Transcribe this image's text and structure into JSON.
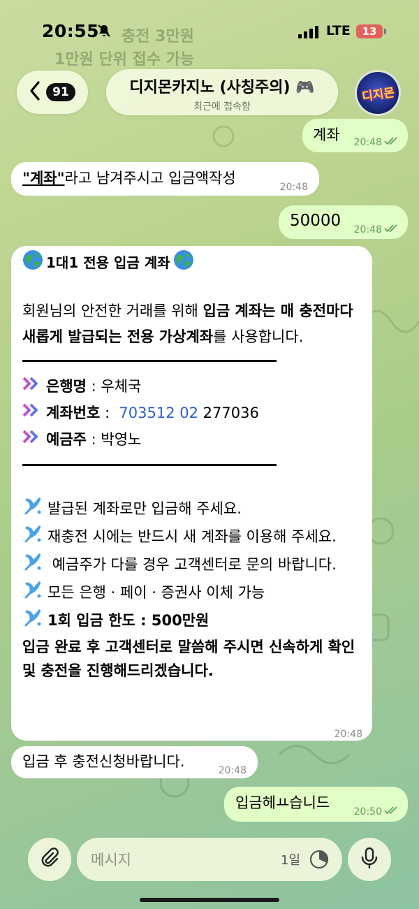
{
  "status_bar": {
    "time": "20:55",
    "network": "LTE",
    "battery": "13"
  },
  "background_ghost_text": [
    "충전 3만원",
    "1만원 단위 접수 가능"
  ],
  "header": {
    "back_count": "91",
    "title": "디지몬카지노 (사칭주의) 🎮",
    "subtitle": "최근에 접속함",
    "avatar_text": "디지몬"
  },
  "messages": {
    "m1": {
      "text": "계좌",
      "time": "20:48"
    },
    "m2": {
      "quoted": "\"계좌\"",
      "rest": "라고 남겨주시고 입금액작성",
      "time": "20:48"
    },
    "m3": {
      "text": "50000",
      "time": "20:48"
    },
    "m4": {
      "heading": "1대1 전용 입금 계좌",
      "para_1": "회원님의 안전한 거래를 위해 ",
      "para_bold": "입금 계좌는 매 충전마다 새롭게 발급되는 전용 가상계좌",
      "para_2": "를 사용합니다.",
      "bank_label": "은행명",
      "bank_value": " : 우체국",
      "account_label": "계좌번호",
      "account_sep": " : ",
      "account_link": "703512 02",
      "account_rest": " 277036",
      "holder_label": "예금주",
      "holder_value": " : 박영노",
      "note_1": "발급된 계좌로만 입금해 주세요.",
      "note_2": "재충전 시에는 반드시 새 계좌를 이용해 주세요.",
      "note_3": " 예금주가 다를 경우 고객센터로 문의 바랍니다.",
      "note_4": "모든 은행 · 페이 · 증권사 이체 가능",
      "note_5": "1회 입금 한도 : 500만원",
      "closing": "입금 완료 후 고객센터로 말씀해 주시면 신속하게 확인 및 충전을 진행해드리겠습니다.",
      "time": "20:48"
    },
    "m5": {
      "text": "입금 후 충전신청바랍니다.",
      "time": "20:48"
    },
    "m6": {
      "text": "입금헤ㅛ습니드",
      "time": "20:50"
    }
  },
  "composer": {
    "placeholder": "메시지",
    "timer_label": "1일"
  },
  "colors": {
    "accent_link": "#2c63c7",
    "outgoing_bubble": "#e1fec6",
    "incoming_bubble": "#ffffff"
  }
}
